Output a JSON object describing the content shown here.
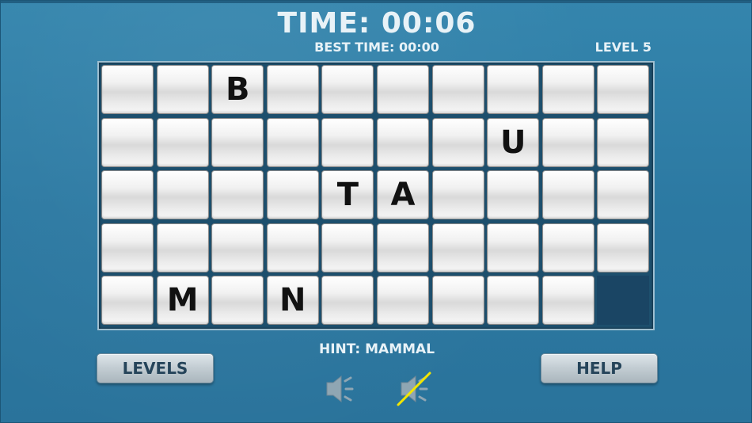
{
  "header": {
    "time_label": "TIME: 00:06",
    "best_time_label": "BEST TIME: 00:00",
    "level_label": "LEVEL 5"
  },
  "board": {
    "rows": 5,
    "cols": 10,
    "letters": [
      [
        "",
        "",
        "B",
        "",
        "",
        "",
        "",
        "",
        "",
        ""
      ],
      [
        "",
        "",
        "",
        "",
        "",
        "",
        "",
        "U",
        "",
        ""
      ],
      [
        "",
        "",
        "",
        "",
        "T",
        "A",
        "",
        "",
        "",
        ""
      ],
      [
        "",
        "",
        "",
        "",
        "",
        "",
        "",
        "",
        "",
        ""
      ],
      [
        "",
        "M",
        "",
        "N",
        "",
        "",
        "",
        "",
        "",
        null
      ]
    ]
  },
  "hint": "HINT: MAMMAL",
  "buttons": {
    "levels_label": "LEVELS",
    "help_label": "HELP"
  },
  "icons": {
    "sound_on": "speaker-icon",
    "sound_off": "speaker-muted-icon"
  },
  "colors": {
    "background": "#2e7aa3",
    "board_empty_slot": "#1a4564",
    "mute_slash": "#f2e600"
  }
}
